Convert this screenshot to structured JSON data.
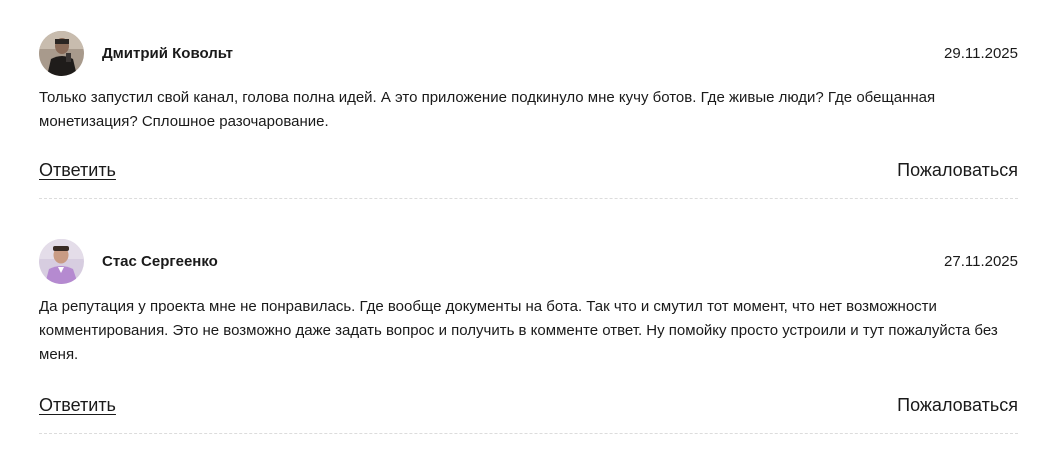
{
  "comments": [
    {
      "author": "Дмитрий Ковольт",
      "avatar_icon": "user-avatar-photo",
      "date": "29.11.2025",
      "text": "Только запустил свой канал, голова полна идей. А это приложение подкинуло мне кучу ботов. Где живые люди? Где обещанная монетизация? Сплошное разочарование.",
      "reply_label": "Ответить",
      "report_label": "Пожаловаться"
    },
    {
      "author": "Стас Сергеенко",
      "avatar_icon": "user-avatar-photo",
      "date": "27.11.2025",
      "text": "Да репутация у проекта мне не понравилась. Где вообще документы на бота. Так что и смутил тот момент, что нет возможности комментирования. Это не возможно даже задать вопрос и получить в комменте ответ. Ну помойку просто устроили и тут пожалуйста без меня.",
      "reply_label": "Ответить",
      "report_label": "Пожаловаться"
    }
  ],
  "colors": {
    "text": "#1a1a1a",
    "divider": "#dcdcdc"
  }
}
